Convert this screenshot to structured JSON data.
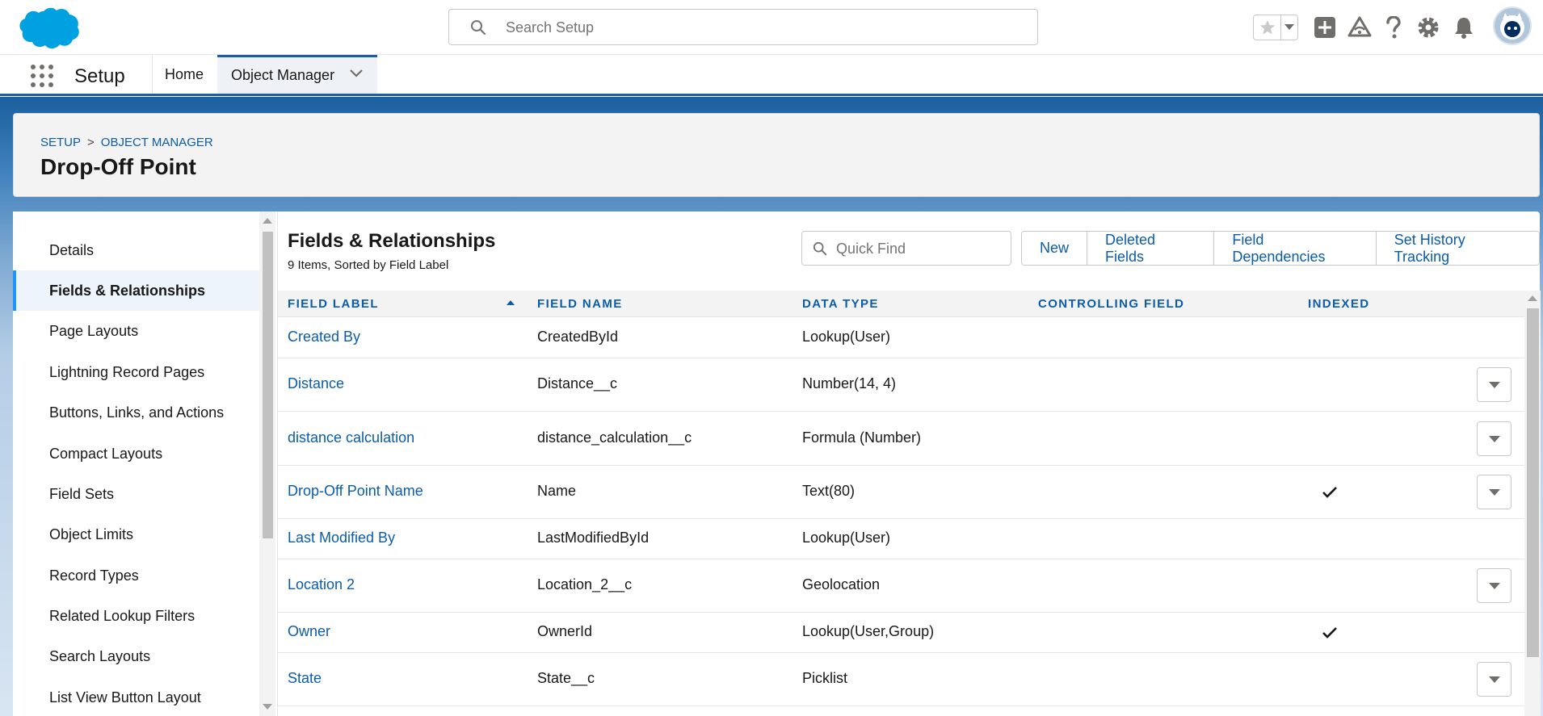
{
  "header": {
    "search_placeholder": "Search Setup"
  },
  "context_bar": {
    "app_name": "Setup",
    "tabs": [
      {
        "label": "Home"
      },
      {
        "label": "Object Manager"
      }
    ]
  },
  "page_header": {
    "breadcrumb": [
      "SETUP",
      ">",
      "OBJECT MANAGER"
    ],
    "title": "Drop-Off Point"
  },
  "sidebar": {
    "items": [
      {
        "label": "Details"
      },
      {
        "label": "Fields & Relationships",
        "active": true
      },
      {
        "label": "Page Layouts"
      },
      {
        "label": "Lightning Record Pages"
      },
      {
        "label": "Buttons, Links, and Actions"
      },
      {
        "label": "Compact Layouts"
      },
      {
        "label": "Field Sets"
      },
      {
        "label": "Object Limits"
      },
      {
        "label": "Record Types"
      },
      {
        "label": "Related Lookup Filters"
      },
      {
        "label": "Search Layouts"
      },
      {
        "label": "List View Button Layout"
      }
    ]
  },
  "main": {
    "title": "Fields & Relationships",
    "subtitle": "9 Items, Sorted by Field Label",
    "quick_find_placeholder": "Quick Find",
    "buttons": [
      "New",
      "Deleted Fields",
      "Field Dependencies",
      "Set History Tracking"
    ],
    "columns": [
      "FIELD LABEL",
      "FIELD NAME",
      "DATA TYPE",
      "CONTROLLING FIELD",
      "INDEXED"
    ],
    "rows": [
      {
        "label": "Created By",
        "name": "CreatedById",
        "type": "Lookup(User)",
        "controlling": "",
        "indexed": false,
        "menu": false
      },
      {
        "label": "Distance",
        "name": "Distance__c",
        "type": "Number(14, 4)",
        "controlling": "",
        "indexed": false,
        "menu": true
      },
      {
        "label": "distance calculation",
        "name": "distance_calculation__c",
        "type": "Formula (Number)",
        "controlling": "",
        "indexed": false,
        "menu": true
      },
      {
        "label": "Drop-Off Point Name",
        "name": "Name",
        "type": "Text(80)",
        "controlling": "",
        "indexed": true,
        "menu": true
      },
      {
        "label": "Last Modified By",
        "name": "LastModifiedById",
        "type": "Lookup(User)",
        "controlling": "",
        "indexed": false,
        "menu": false
      },
      {
        "label": "Location 2",
        "name": "Location_2__c",
        "type": "Geolocation",
        "controlling": "",
        "indexed": false,
        "menu": true
      },
      {
        "label": "Owner",
        "name": "OwnerId",
        "type": "Lookup(User,Group)",
        "controlling": "",
        "indexed": true,
        "menu": false
      },
      {
        "label": "State",
        "name": "State__c",
        "type": "Picklist",
        "controlling": "",
        "indexed": false,
        "menu": true
      }
    ]
  }
}
